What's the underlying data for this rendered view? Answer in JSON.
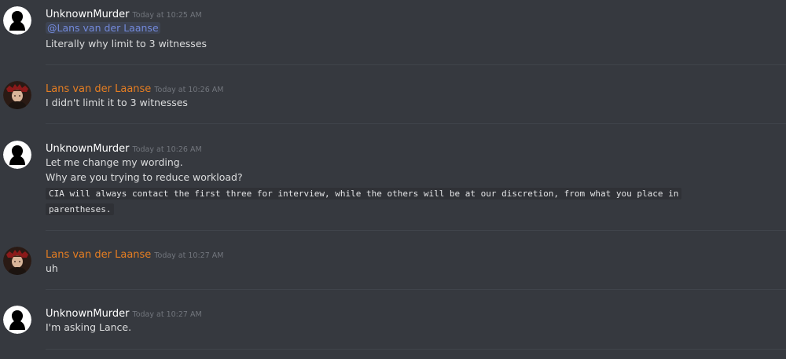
{
  "colors": {
    "background": "#36393f",
    "unknown_username": "#ffffff",
    "lans_username": "#e67e22",
    "mention": "#7289da",
    "timestamp": "#72767d",
    "code_bg": "#2f3136"
  },
  "messages": [
    {
      "author": "UnknownMurder",
      "timestamp": "Today at 10:25 AM",
      "avatar_icon": "silhouette-avatar-icon",
      "mention": "@Lans van der Laanse",
      "lines": [
        "Literally why limit to 3 witnesses"
      ]
    },
    {
      "author": "Lans van der Laanse",
      "timestamp": "Today at 10:26 AM",
      "avatar_icon": "portrait-avatar-icon",
      "lines": [
        "I didn't limit it to 3 witnesses"
      ]
    },
    {
      "author": "UnknownMurder",
      "timestamp": "Today at 10:26 AM",
      "avatar_icon": "silhouette-avatar-icon",
      "lines": [
        "Let me change my wording.",
        "Why are you trying to reduce workload?"
      ],
      "code_lines": [
        "CIA will always contact the first three for interview, while the others will be at our discretion, from what you place in",
        "parentheses."
      ]
    },
    {
      "author": "Lans van der Laanse",
      "timestamp": "Today at 10:27 AM",
      "avatar_icon": "portrait-avatar-icon",
      "lines": [
        "uh"
      ]
    },
    {
      "author": "UnknownMurder",
      "timestamp": "Today at 10:27 AM",
      "avatar_icon": "silhouette-avatar-icon",
      "lines": [
        "I'm asking Lance."
      ]
    }
  ]
}
